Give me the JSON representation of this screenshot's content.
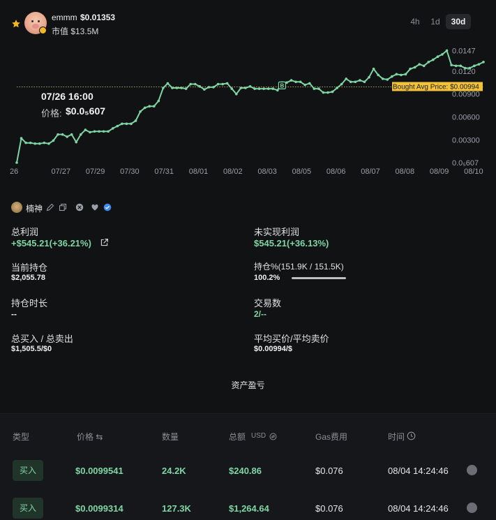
{
  "header": {
    "token_name": "emmm",
    "token_price": "$0.01353",
    "market_cap": "市值 $13.5M",
    "timeframes": [
      "4h",
      "1d",
      "30d"
    ],
    "active_timeframe": "30d"
  },
  "tooltip": {
    "date": "07/26 16:00",
    "price_label": "价格:",
    "price": "$0.0₅607"
  },
  "chart_data": {
    "type": "line",
    "x_tick_labels": [
      "26",
      "07/27",
      "07/29",
      "07/30",
      "07/31",
      "08/01",
      "08/02",
      "08/03",
      "08/05",
      "08/06",
      "08/07",
      "08/08",
      "08/09",
      "08/10"
    ],
    "y_tick_labels": [
      "0.0147",
      "0.0120",
      "0.00900",
      "0.00600",
      "0.00300",
      "0.0₅607"
    ],
    "y_ticks": [
      0.0147,
      0.012,
      0.009,
      0.006,
      0.003,
      6.07e-06
    ],
    "ylim": [
      6.07e-06,
      0.0152
    ],
    "series": [
      {
        "values": [
          6.07e-06,
          0.0032,
          0.0026,
          0.0026,
          0.0025,
          0.0025,
          0.0026,
          0.0025,
          0.0029,
          0.0037,
          0.0037,
          0.0034,
          0.0037,
          0.0027,
          0.0037,
          0.0043,
          0.004,
          0.0041,
          0.0041,
          0.0041,
          0.0041,
          0.0045,
          0.0048,
          0.0051,
          0.0051,
          0.0051,
          0.0055,
          0.0067,
          0.0072,
          0.0074,
          0.0074,
          0.0081,
          0.0098,
          0.0104,
          0.0098,
          0.0098,
          0.0098,
          0.0097,
          0.0103,
          0.0103,
          0.01,
          0.0096,
          0.0099,
          0.0099,
          0.0103,
          0.0103,
          0.0104,
          0.0097,
          0.009,
          0.0098,
          0.0098,
          0.01,
          0.0097,
          0.0097,
          0.0097,
          0.0097,
          0.0097,
          0.0095,
          0.0105,
          0.0105,
          0.0108,
          0.0106,
          0.0106,
          0.0102,
          0.0104,
          0.0097,
          0.0097,
          0.0092,
          0.0092,
          0.0093,
          0.0098,
          0.0103,
          0.011,
          0.0106,
          0.0106,
          0.0108,
          0.0106,
          0.0112,
          0.0123,
          0.0115,
          0.011,
          0.0109,
          0.0113,
          0.0116,
          0.0115,
          0.0116,
          0.0123,
          0.0125,
          0.0129,
          0.0127,
          0.0132,
          0.0135,
          0.0139,
          0.0142,
          0.0147,
          0.0128,
          0.0127,
          0.0127,
          0.0124,
          0.0124,
          0.0127,
          0.0129,
          0.0132
        ]
      }
    ],
    "reference_line": {
      "label": "Bought Avg Price: $0.00994",
      "value": 0.00994
    },
    "marker": {
      "label": "B",
      "index": 58
    },
    "grid": false,
    "line_color": "#7fd6a4"
  },
  "wallet": {
    "name": "楠神"
  },
  "stats": {
    "total_profit_label": "总利润",
    "total_profit_value": "+$545.21(+36.21%)",
    "unrealized_label": "未实现利润",
    "unrealized_value": "$545.21(+36.13%)",
    "holding_label": "当前持仓",
    "holding_value": "$2,055.78",
    "holding_pct_label": "持仓%(151.9K / 151.5K)",
    "holding_pct_value": "100.2%",
    "holding_pct_fill": 1.0,
    "hold_duration_label": "持仓时长",
    "hold_duration_value": "--",
    "trades_label": "交易数",
    "trades_value": "2/--",
    "buy_sell_label": "总买入 / 总卖出",
    "buy_sell_value": "$1,505.5/$0",
    "avg_price_label": "平均买价/平均卖价",
    "avg_price_value": "$0.00994/$"
  },
  "assets_label": "资产盈亏",
  "table": {
    "headers": [
      "类型",
      "价格 ⇆",
      "数量",
      "总额",
      "USD",
      "Gas费用",
      "时间"
    ],
    "rows": [
      {
        "type": "买入",
        "price": "$0.0099541",
        "qty": "24.2K",
        "total": "$240.86",
        "gas": "$0.076",
        "time": "08/04 14:24:46"
      },
      {
        "type": "买入",
        "price": "$0.0099314",
        "qty": "127.3K",
        "total": "$1,264.64",
        "gas": "$0.076",
        "time": "08/04 14:24:46"
      }
    ]
  },
  "colors": {
    "accent_green": "#7fd6a4",
    "ref_label_bg": "#f2c23a",
    "background": "#111214"
  }
}
